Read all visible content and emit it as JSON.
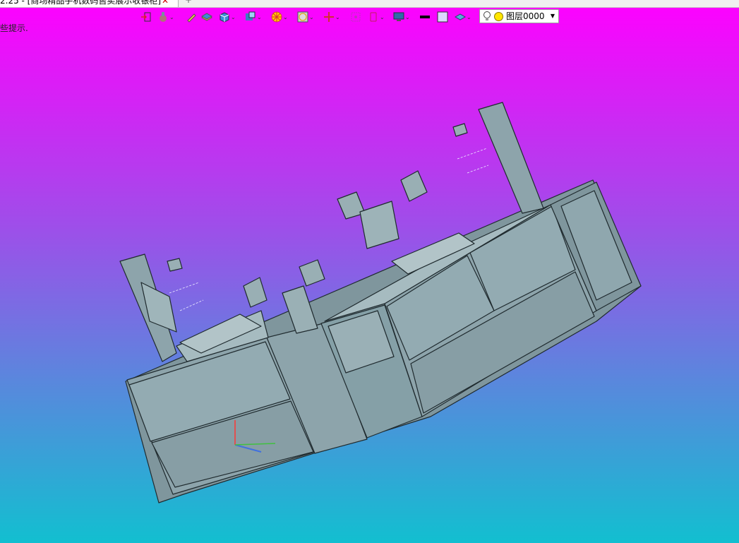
{
  "window": {
    "tab_title": "2.25 - [商场精品手机数码售卖展示收银柜]",
    "tab_close": "✕",
    "new_tab": "+"
  },
  "status": {
    "hint": "些提示."
  },
  "toolbar": {
    "icons": [
      "exit-icon",
      "brush-icon",
      "pencil-icon",
      "layers-icon",
      "box-icon",
      "insert-icon",
      "color-wheel-icon",
      "render-icon",
      "axis-icon",
      "select-icon",
      "bracket-icon",
      "monitor-icon",
      "line-color-icon",
      "fill-color-icon",
      "layer-stack-icon"
    ]
  },
  "layer": {
    "name": "图层0000",
    "current": "图层0000"
  },
  "model": {
    "description": "3D cabinet model",
    "fill_color": "#8da4ab",
    "edge_color": "#1f2a2e"
  }
}
